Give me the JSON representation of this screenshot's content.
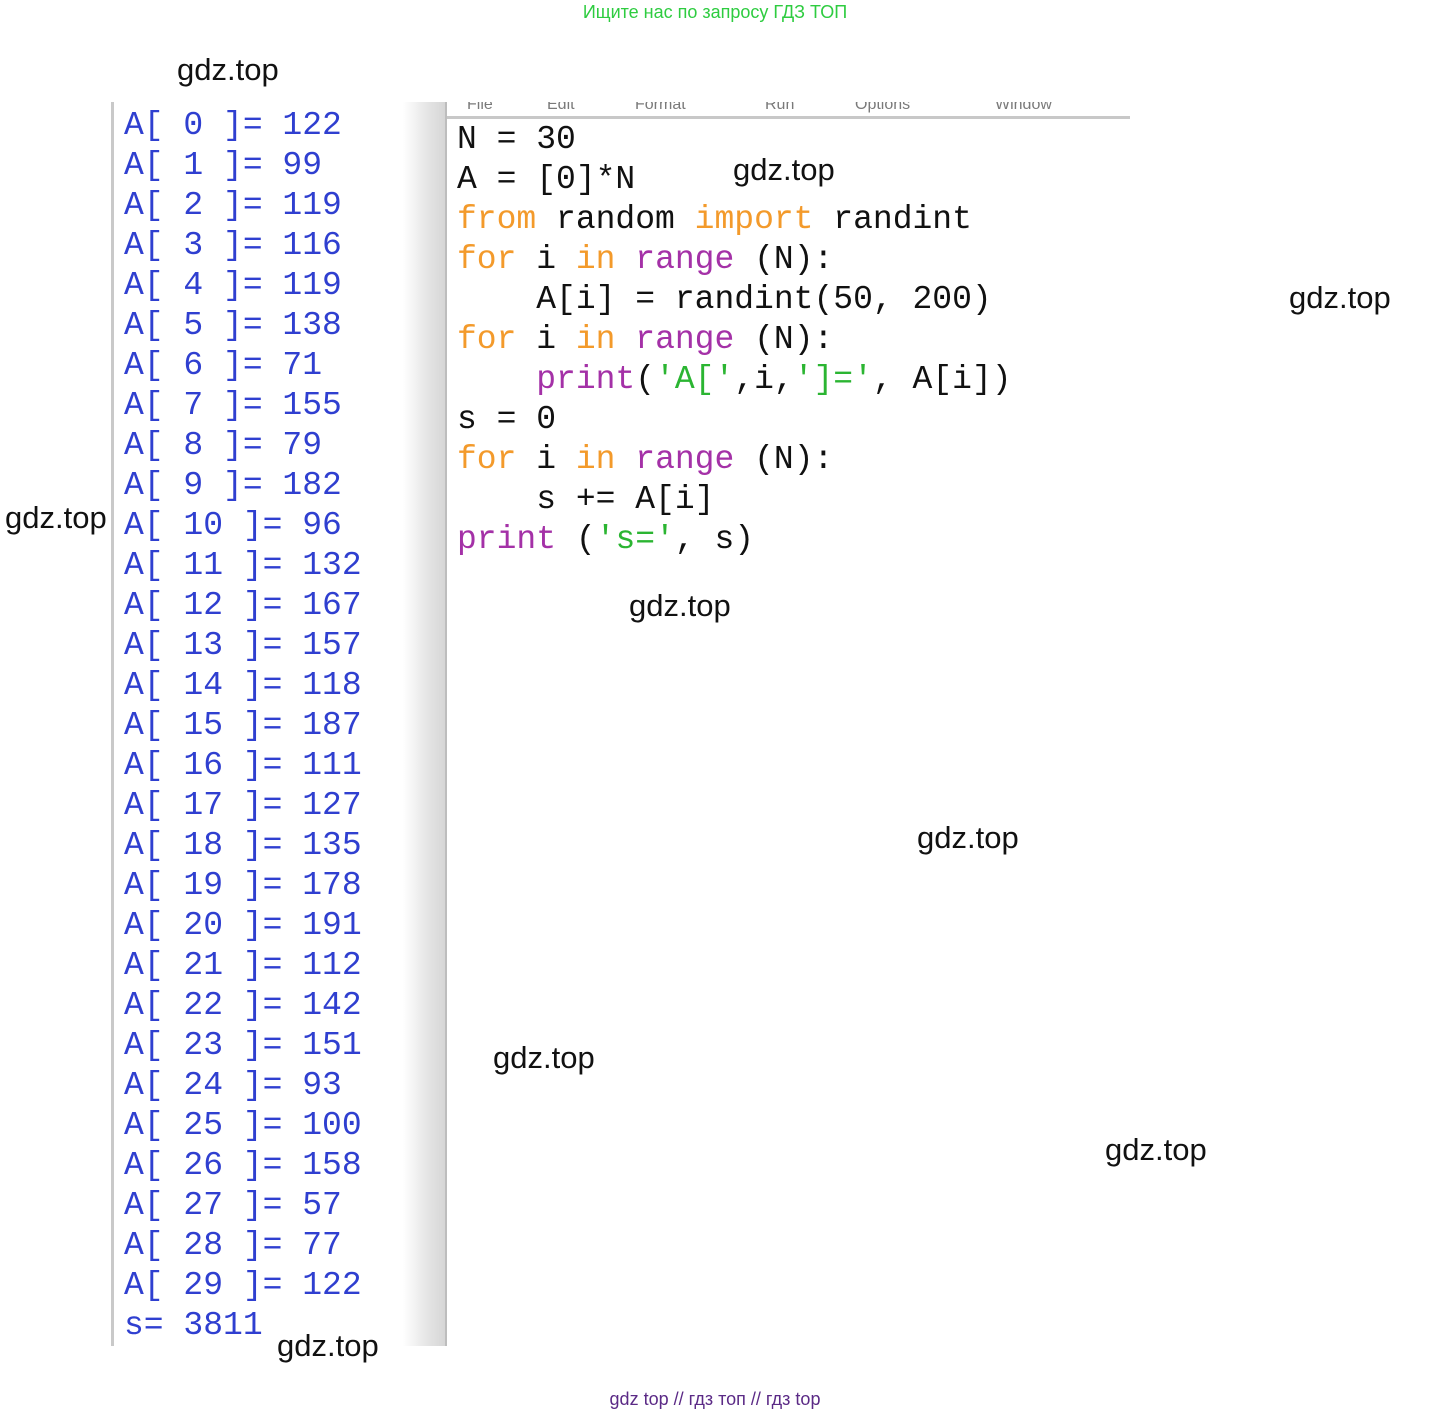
{
  "banner_top": "Ищите нас по запросу ГДЗ ТОП",
  "banner_bottom": "gdz top  //  гдз топ  //  гдз top",
  "watermarks": [
    "gdz.top",
    "gdz.top",
    "gdz.top",
    "gdz.top",
    "gdz.top",
    "gdz.top",
    "gdz.top",
    "gdz.top",
    "gdz.top"
  ],
  "colors": {
    "output_text": "#2f3fd0",
    "keyword": "#f39a2b",
    "builtin": "#a431a7",
    "string": "#2bb532",
    "code_text": "#111111",
    "banner_top": "#2ecc40",
    "banner_bottom": "#5b2a86"
  },
  "shell": {
    "lines": [
      "A[ 0 ]= 122",
      "A[ 1 ]= 99",
      "A[ 2 ]= 119",
      "A[ 3 ]= 116",
      "A[ 4 ]= 119",
      "A[ 5 ]= 138",
      "A[ 6 ]= 71",
      "A[ 7 ]= 155",
      "A[ 8 ]= 79",
      "A[ 9 ]= 182",
      "A[ 10 ]= 96",
      "A[ 11 ]= 132",
      "A[ 12 ]= 167",
      "A[ 13 ]= 157",
      "A[ 14 ]= 118",
      "A[ 15 ]= 187",
      "A[ 16 ]= 111",
      "A[ 17 ]= 127",
      "A[ 18 ]= 135",
      "A[ 19 ]= 178",
      "A[ 20 ]= 191",
      "A[ 21 ]= 112",
      "A[ 22 ]= 142",
      "A[ 23 ]= 151",
      "A[ 24 ]= 93",
      "A[ 25 ]= 100",
      "A[ 26 ]= 158",
      "A[ 27 ]= 57",
      "A[ 28 ]= 77",
      "A[ 29 ]= 122"
    ],
    "sum_line": "s= 3811"
  },
  "editor": {
    "menu": [
      "File",
      "Edit",
      "Format",
      "Run",
      "Options",
      "Window"
    ],
    "code": [
      [
        {
          "t": "N = 30",
          "c": ""
        }
      ],
      [
        {
          "t": "A = [0]*N",
          "c": ""
        }
      ],
      [
        {
          "t": "from",
          "c": "kw"
        },
        {
          "t": " random ",
          "c": ""
        },
        {
          "t": "import",
          "c": "kw"
        },
        {
          "t": " randint",
          "c": ""
        }
      ],
      [
        {
          "t": "for",
          "c": "kw"
        },
        {
          "t": " i ",
          "c": ""
        },
        {
          "t": "in",
          "c": "kw"
        },
        {
          "t": " ",
          "c": ""
        },
        {
          "t": "range",
          "c": "bi"
        },
        {
          "t": " (N):",
          "c": ""
        }
      ],
      [
        {
          "t": "    A[i] = randint(50, 200)",
          "c": ""
        }
      ],
      [
        {
          "t": "for",
          "c": "kw"
        },
        {
          "t": " i ",
          "c": ""
        },
        {
          "t": "in",
          "c": "kw"
        },
        {
          "t": " ",
          "c": ""
        },
        {
          "t": "range",
          "c": "bi"
        },
        {
          "t": " (N):",
          "c": ""
        }
      ],
      [
        {
          "t": "    ",
          "c": ""
        },
        {
          "t": "print",
          "c": "bi"
        },
        {
          "t": "(",
          "c": ""
        },
        {
          "t": "'A['",
          "c": "st"
        },
        {
          "t": ",i,",
          "c": ""
        },
        {
          "t": "']='",
          "c": "st"
        },
        {
          "t": ", A[i])",
          "c": ""
        }
      ],
      [
        {
          "t": "s = 0",
          "c": ""
        }
      ],
      [
        {
          "t": "for",
          "c": "kw"
        },
        {
          "t": " i ",
          "c": ""
        },
        {
          "t": "in",
          "c": "kw"
        },
        {
          "t": " ",
          "c": ""
        },
        {
          "t": "range",
          "c": "bi"
        },
        {
          "t": " (N):",
          "c": ""
        }
      ],
      [
        {
          "t": "    s += A[i]",
          "c": ""
        }
      ],
      [
        {
          "t": "print",
          "c": "bi"
        },
        {
          "t": " (",
          "c": ""
        },
        {
          "t": "'s='",
          "c": "st"
        },
        {
          "t": ", s)",
          "c": ""
        }
      ]
    ]
  }
}
